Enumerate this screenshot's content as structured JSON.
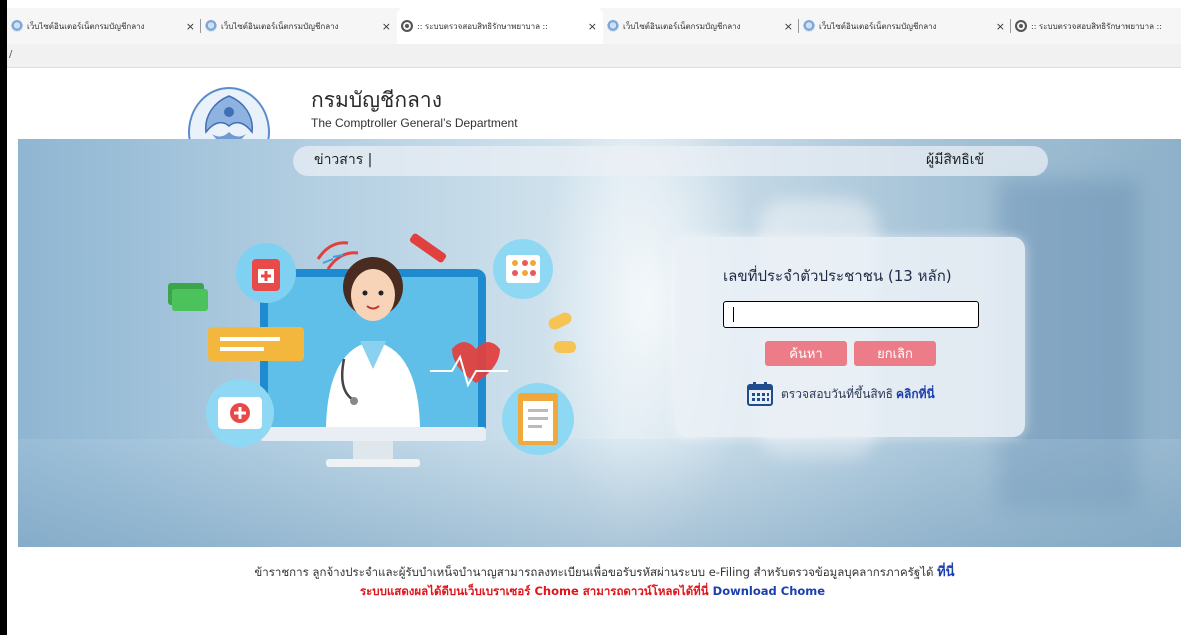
{
  "browser": {
    "tabs": [
      {
        "title": "เว็บไซต์อินเตอร์เน็ตกรมบัญชีกลาง",
        "icon": "emblem-icon",
        "active": false
      },
      {
        "title": "เว็บไซต์อินเตอร์เน็ตกรมบัญชีกลาง",
        "icon": "emblem-icon",
        "active": false
      },
      {
        "title": ":: ระบบตรวจสอบสิทธิรักษาพยาบาล ::",
        "icon": "globe-icon",
        "active": true
      },
      {
        "title": "เว็บไซต์อินเตอร์เน็ตกรมบัญชีกลาง",
        "icon": "emblem-icon",
        "active": false
      },
      {
        "title": "เว็บไซต์อินเตอร์เน็ตกรมบัญชีกลาง",
        "icon": "emblem-icon",
        "active": false
      },
      {
        "title": ":: ระบบตรวจสอบสิทธิรักษาพยาบาล ::",
        "icon": "globe-icon",
        "active": false
      }
    ],
    "close_glyph": "×",
    "url_fragment": "/"
  },
  "header": {
    "org_name_th": "กรมบัญชีกลาง",
    "org_name_en": "The Comptroller General’s Department",
    "logo_text": "กรมบัญชีกลาง"
  },
  "nav": {
    "news_label": "ข่าวสาร |",
    "authorized_user_label": "ผู้มีสิทธิเข้"
  },
  "login": {
    "title": "เลขที่ประจำตัวประชาชน (13 หลัก)",
    "input_value": "",
    "search_label": "ค้นหา",
    "cancel_label": "ยกเลิก",
    "check_text": "ตรวจสอบวันที่ขึ้นสิทธิ",
    "check_link": "คลิกที่นี่"
  },
  "footer": {
    "notice_text": "ข้าราชการ ลูกจ้างประจำและผู้รับบำเหน็จบำนาญสามารถลงทะเบียนเพื่อขอรับรหัสผ่านระบบ e-Filing สำหรับตรวจข้อมูลบุคลากรภาครัฐได้",
    "notice_link": "ที่นี่",
    "browser_notice": "ระบบแสดงผลได้ดีบนเว็บเบราเซอร์  Chome สามารถดาวน์โหลดได้ที่นี่",
    "download_link": "Download Chome"
  },
  "colors": {
    "button": "#ec7d88",
    "link": "#1b3fae",
    "warning": "#e0141b"
  }
}
